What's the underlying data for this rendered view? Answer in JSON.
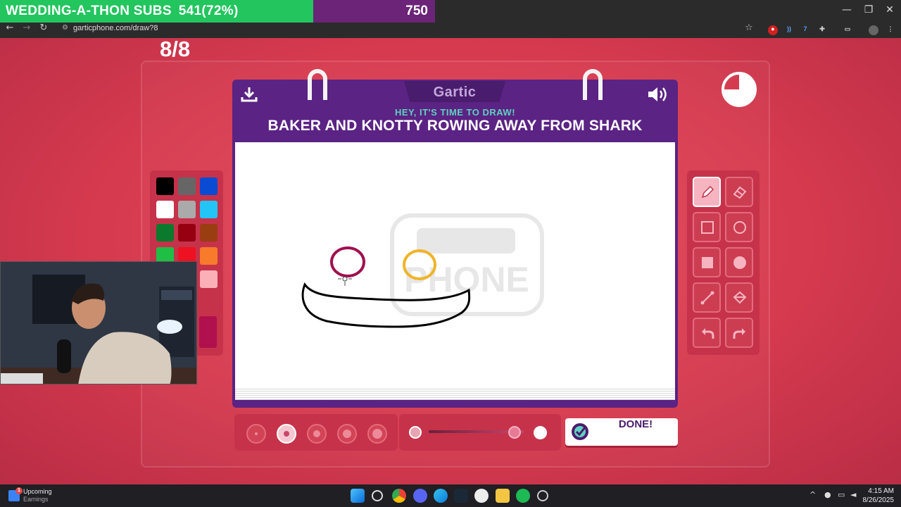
{
  "overlay": {
    "sub_goal_label": "WEDDING-A-THON SUBS",
    "sub_progress_text": "541(72%)",
    "sub_progress_fraction": 0.72,
    "goal_count": "750"
  },
  "window": {
    "minimize": "—",
    "restore": "❐",
    "close": "✕"
  },
  "browser": {
    "url": "garticphone.com/draw?8",
    "back": "←",
    "forward": "→",
    "reload": "↻"
  },
  "game": {
    "round": "8/8",
    "logo": "Gartic",
    "instruction": "HEY, IT'S TIME TO DRAW!",
    "prompt": "BAKER AND KNOTTY ROWING AWAY FROM SHARK",
    "done_label": "DONE!",
    "timer_remaining_fraction": 0.75,
    "palette": [
      "#000000",
      "#666666",
      "#0a4bd4",
      "#ffffff",
      "#aaaaaa",
      "#22c5f5",
      "#0b7a2c",
      "#960010",
      "#9a3e12",
      "#1fbf45",
      "#ee1122",
      "#f77b2b",
      "#c9486a",
      "#c84b5a",
      "#fbb0b8",
      "#b0104e"
    ],
    "selected_color": "#b0104e",
    "brush_sizes": 5,
    "selected_brush_index": 1,
    "opacity_level": 0.9,
    "tools": [
      "pencil-icon",
      "eraser-icon",
      "rectangle-outline-icon",
      "circle-outline-icon",
      "rectangle-fill-icon",
      "circle-fill-icon",
      "line-icon",
      "bucket-icon",
      "undo-icon",
      "redo-icon"
    ],
    "active_tool": "pencil-icon"
  },
  "taskbar": {
    "widget_title": "Upcoming",
    "widget_subtitle": "Earnings",
    "widget_badge": "1",
    "time": "4:15 AM",
    "date": "8/26/2025"
  }
}
